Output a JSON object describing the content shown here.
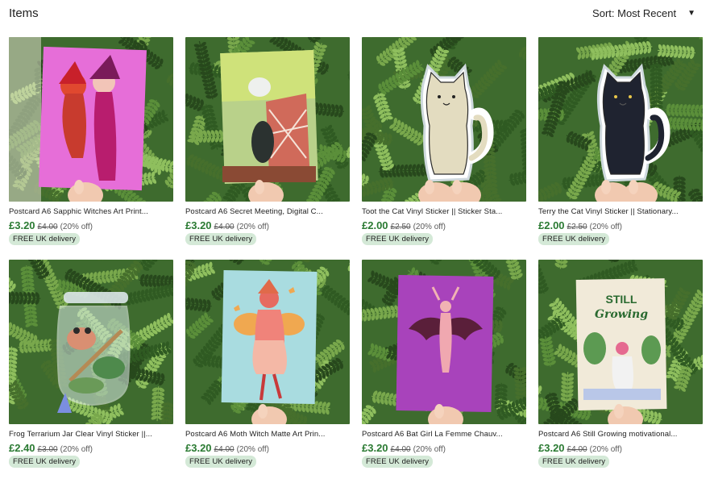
{
  "header": {
    "title": "Items",
    "sort_label": "Sort: Most Recent",
    "sort_caret": "▼"
  },
  "items": [
    {
      "name": "Postcard A6 Sapphic Witches Art Print...",
      "price": "£3.20",
      "original": "£4.00",
      "discount": "(20% off)",
      "badge": "FREE UK delivery",
      "art": "witches",
      "accent": "#e66ed8"
    },
    {
      "name": "Postcard A6 Secret Meeting, Digital C...",
      "price": "£3.20",
      "original": "£4.00",
      "discount": "(20% off)",
      "badge": "FREE UK delivery",
      "art": "secret-meeting",
      "accent": "#b25a4a"
    },
    {
      "name": "Toot the Cat Vinyl Sticker || Sticker Sta...",
      "price": "£2.00",
      "original": "£2.50",
      "discount": "(20% off)",
      "badge": "FREE UK delivery",
      "art": "cat-beige",
      "accent": "#e3dcc0"
    },
    {
      "name": "Terry the Cat Vinyl Sticker || Stationary...",
      "price": "£2.00",
      "original": "£2.50",
      "discount": "(20% off)",
      "badge": "FREE UK delivery",
      "art": "cat-black",
      "accent": "#1f2330"
    },
    {
      "name": "Frog Terrarium Jar Clear Vinyl Sticker ||...",
      "price": "£2.40",
      "original": "£3.00",
      "discount": "(20% off)",
      "badge": "FREE UK delivery",
      "art": "frog-jar",
      "accent": "#cfe3d8"
    },
    {
      "name": "Postcard A6 Moth Witch Matte Art Prin...",
      "price": "£3.20",
      "original": "£4.00",
      "discount": "(20% off)",
      "badge": "FREE UK delivery",
      "art": "moth-witch",
      "accent": "#a9dce0"
    },
    {
      "name": "Postcard A6 Bat Girl La Femme Chauv...",
      "price": "£3.20",
      "original": "£4.00",
      "discount": "(20% off)",
      "badge": "FREE UK delivery",
      "art": "bat-girl",
      "accent": "#9b38b0"
    },
    {
      "name": "Postcard A6 Still Growing motivational...",
      "price": "£3.20",
      "original": "£4.00",
      "discount": "(20% off)",
      "badge": "FREE UK delivery",
      "art": "still-growing",
      "accent": "#f1ead9",
      "art_text": [
        "STILL",
        "Growing"
      ]
    }
  ]
}
